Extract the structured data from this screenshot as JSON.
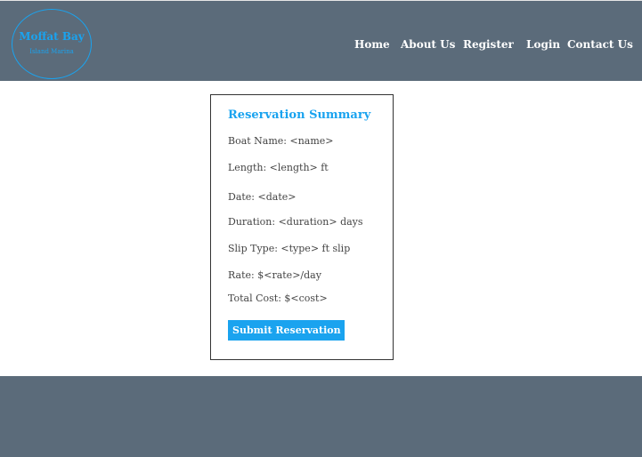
{
  "header": {
    "logo": {
      "title": "Moffat Bay",
      "subtitle": "Island Marina"
    },
    "nav": {
      "home": "Home",
      "about": "About Us",
      "register": "Register",
      "login": "Login",
      "contact": "Contact Us"
    }
  },
  "summary": {
    "title": "Reservation Summary",
    "boat_name": "Boat Name: <name>",
    "length": "Length: <length> ft",
    "date": "Date: <date>",
    "duration": "Duration: <duration> days",
    "slip_type": "Slip Type: <type> ft slip",
    "rate": "Rate: $<rate>/day",
    "total_cost": "Total Cost: $<cost>",
    "submit_label": "Submit Reservation"
  },
  "colors": {
    "header_bg": "#5b6b7a",
    "accent": "#1aa3ef",
    "footer_bg": "#5b6b7a"
  }
}
